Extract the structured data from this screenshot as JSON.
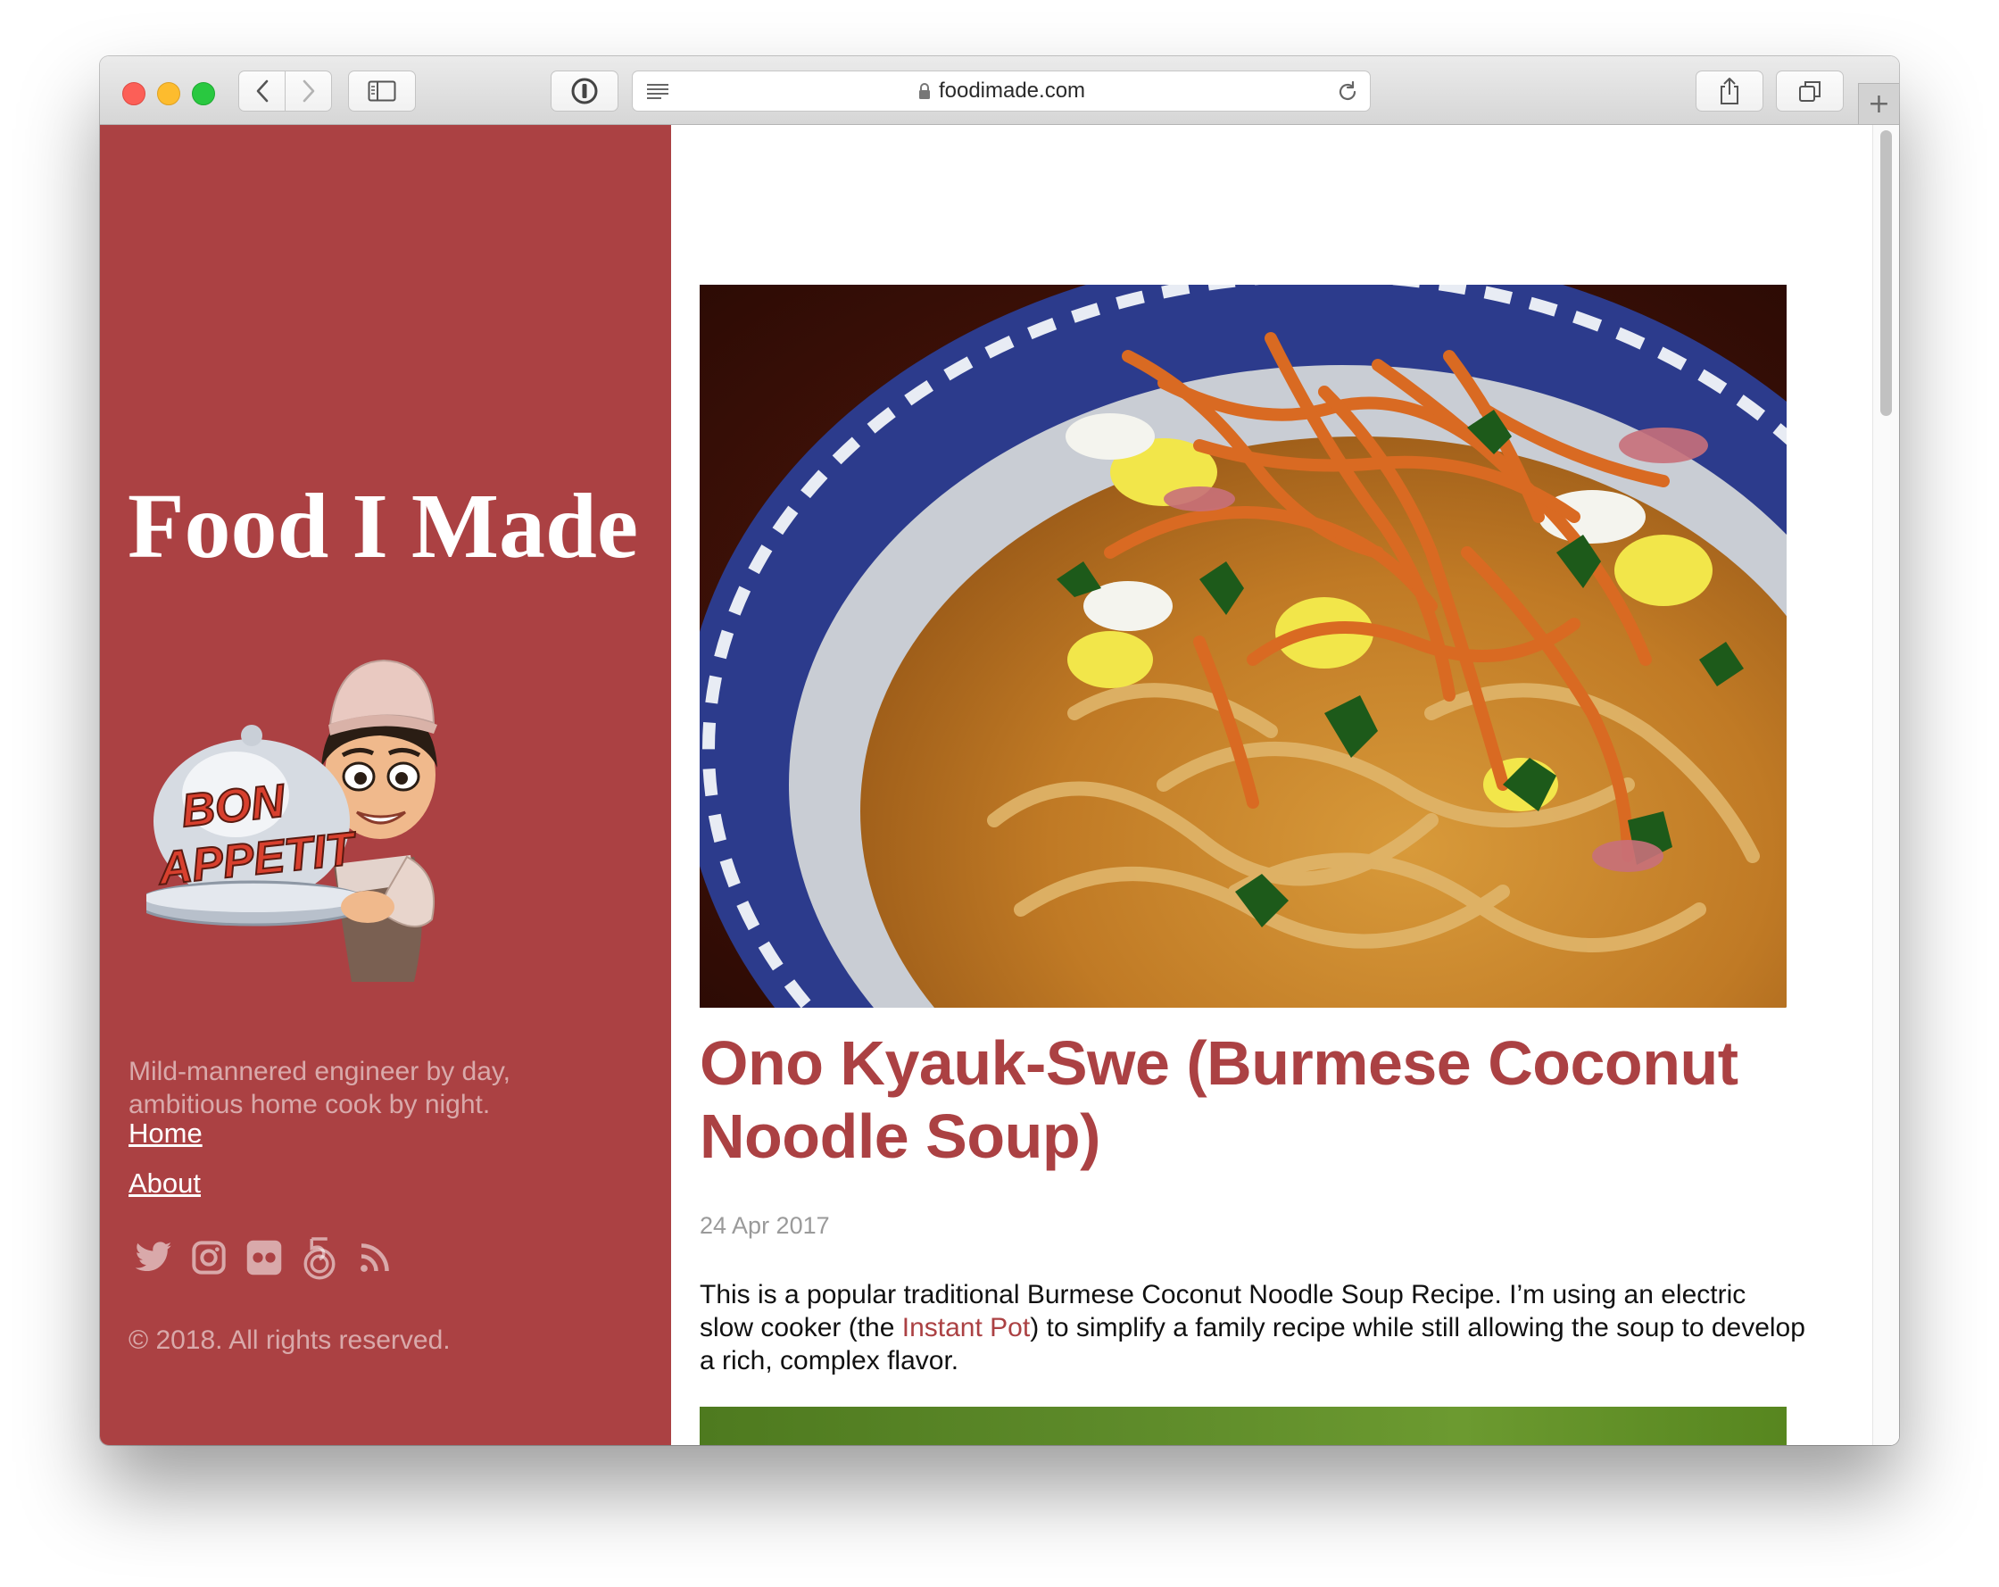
{
  "browser": {
    "url": "foodimade.com",
    "new_tab_symbol": "+"
  },
  "sidebar": {
    "site_title": "Food I Made",
    "avatar_badge_line1": "BON",
    "avatar_badge_line2": "APPETIT",
    "tagline": "Mild-mannered engineer by day, ambitious home cook by night.",
    "nav": [
      {
        "label": "Home"
      },
      {
        "label": "About"
      }
    ],
    "social_icons": [
      "twitter-icon",
      "instagram-icon",
      "flickr-icon",
      "500px-icon",
      "rss-icon"
    ],
    "copyright": "© 2018. All rights reserved.",
    "background_color": "#ab4143"
  },
  "post": {
    "title": "Ono Kyauk-Swe (Burmese Coconut Noodle Soup)",
    "date": "24 Apr 2017",
    "body_before_link": "This is a popular traditional Burmese Coconut Noodle Soup Recipe. I’m using an electric slow cooker (the ",
    "body_link": "Instant Pot",
    "body_after_link": ") to simplify a family recipe while still allowing the soup to develop a rich, complex flavor.",
    "accent_color": "#ab4143"
  }
}
